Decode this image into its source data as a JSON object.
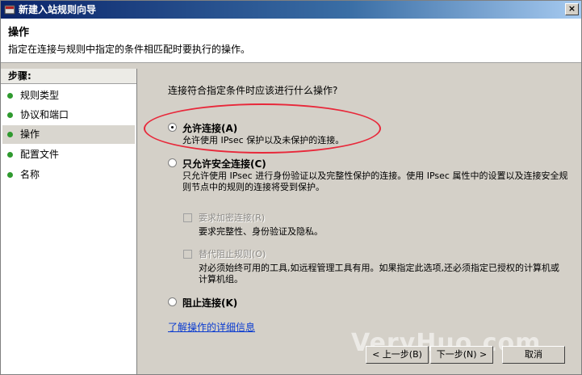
{
  "window": {
    "title": "新建入站规则向导",
    "close_glyph": "×"
  },
  "header": {
    "title": "操作",
    "description": "指定在连接与规则中指定的条件相匹配时要执行的操作。"
  },
  "steps": {
    "title": "步骤:",
    "items": [
      {
        "label": "规则类型"
      },
      {
        "label": "协议和端口"
      },
      {
        "label": "操作"
      },
      {
        "label": "配置文件"
      },
      {
        "label": "名称"
      }
    ]
  },
  "content": {
    "question": "连接符合指定条件时应该进行什么操作?",
    "options": [
      {
        "label": "允许连接(A)",
        "desc": "允许使用 IPsec 保护以及未保护的连接。",
        "selected": true
      },
      {
        "label": "只允许安全连接(C)",
        "desc": "只允许使用 IPsec 进行身份验证以及完整性保护的连接。使用 IPsec 属性中的设置以及连接安全规则节点中的规则的连接将受到保护。",
        "selected": false
      },
      {
        "label": "阻止连接(K)",
        "selected": false
      }
    ],
    "sub_options": [
      {
        "label": "要求加密连接(R)",
        "desc": "要求完整性、身份验证及隐私。"
      },
      {
        "label": "替代阻止规则(O)",
        "desc": "对必须始终可用的工具,如远程管理工具有用。如果指定此选项,还必须指定已授权的计算机或计算机组。"
      }
    ],
    "link": "了解操作的详细信息"
  },
  "buttons": {
    "back": "< 上一步(B)",
    "next": "下一步(N) >",
    "cancel": "取消"
  },
  "watermark": "VeryHuo.com",
  "colors": {
    "highlight": "#e8283a",
    "link": "#0a3bd0",
    "step_dot": "#2f9a2f"
  }
}
